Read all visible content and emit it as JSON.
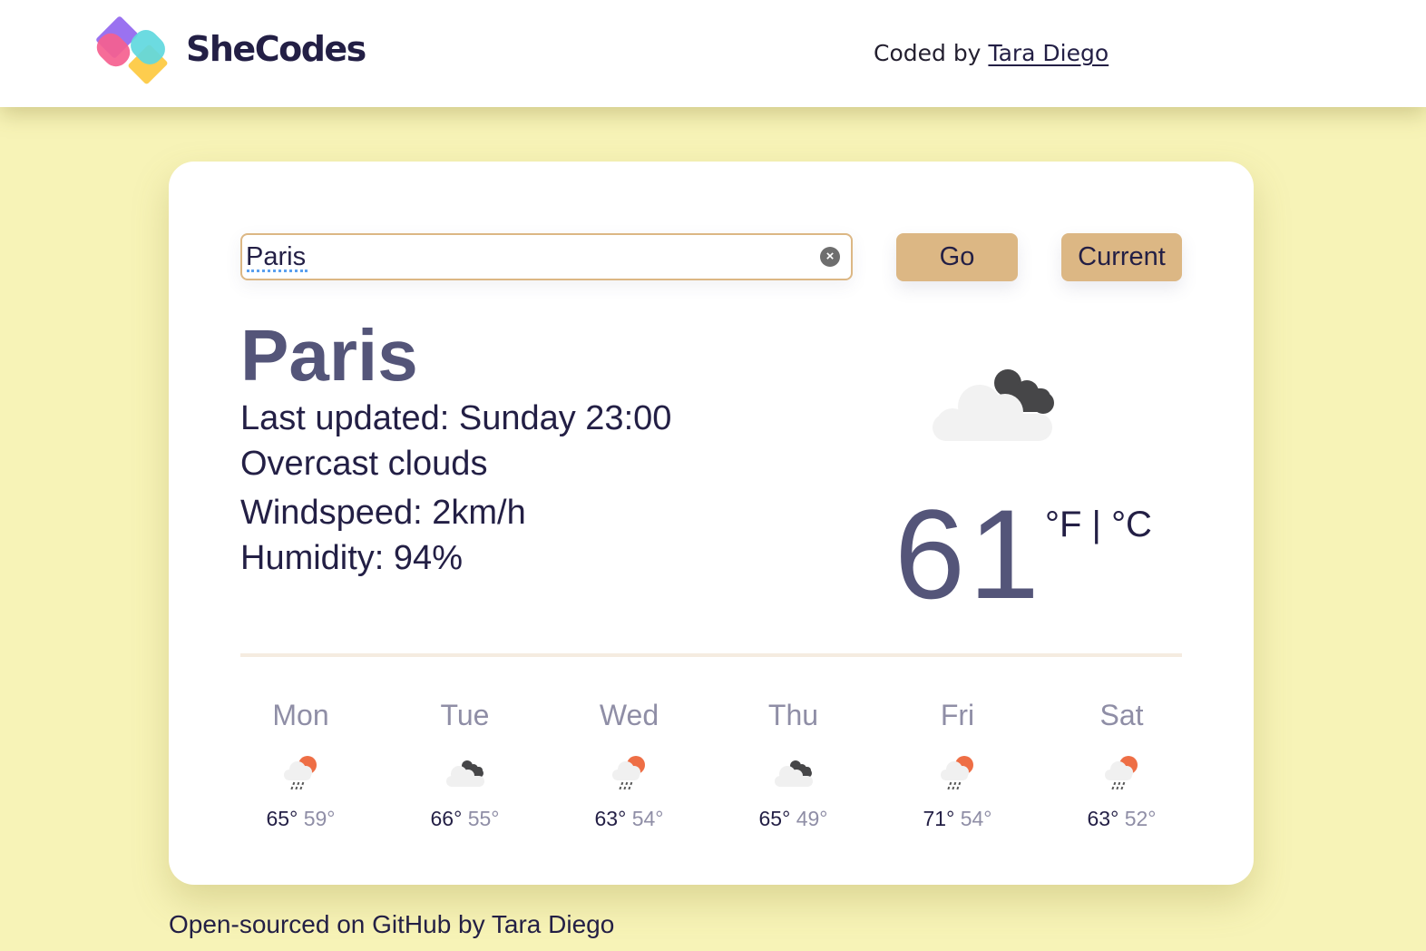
{
  "header": {
    "brand": "SheCodes",
    "coded_by_prefix": "Coded by ",
    "coded_by_name": "Tara Diego"
  },
  "search": {
    "value": "Paris",
    "clear_icon": "clear-circle-icon",
    "go_label": "Go",
    "current_label": "Current"
  },
  "current": {
    "city": "Paris",
    "last_updated": "Last updated: Sunday 23:00",
    "description": "Overcast clouds",
    "windspeed": "Windspeed: 2km/h",
    "humidity": "Humidity: 94%",
    "icon": "overcast-clouds-icon",
    "temperature": "61",
    "unit_f": "°F",
    "unit_sep": " | ",
    "unit_c": "°C"
  },
  "forecast": [
    {
      "day": "Mon",
      "icon": "rain-sun-icon",
      "max": "65°",
      "min": "59°"
    },
    {
      "day": "Tue",
      "icon": "overcast-clouds-icon",
      "max": "66°",
      "min": "55°"
    },
    {
      "day": "Wed",
      "icon": "rain-sun-icon",
      "max": "63°",
      "min": "54°"
    },
    {
      "day": "Thu",
      "icon": "overcast-clouds-icon",
      "max": "65°",
      "min": "49°"
    },
    {
      "day": "Fri",
      "icon": "rain-sun-icon",
      "max": "71°",
      "min": "54°"
    },
    {
      "day": "Sat",
      "icon": "rain-sun-icon",
      "max": "63°",
      "min": "52°"
    }
  ],
  "footer": {
    "link_text": "Open-sourced on GitHub",
    "suffix": " by Tara Diego"
  },
  "colors": {
    "background": "#f7f3b7",
    "accent_button": "#dcb784",
    "primary_text": "#231f45",
    "muted_text": "#8f8ea6",
    "city_text": "#545579",
    "sun_orange": "#ee6e45",
    "dark_cloud": "#464648"
  }
}
